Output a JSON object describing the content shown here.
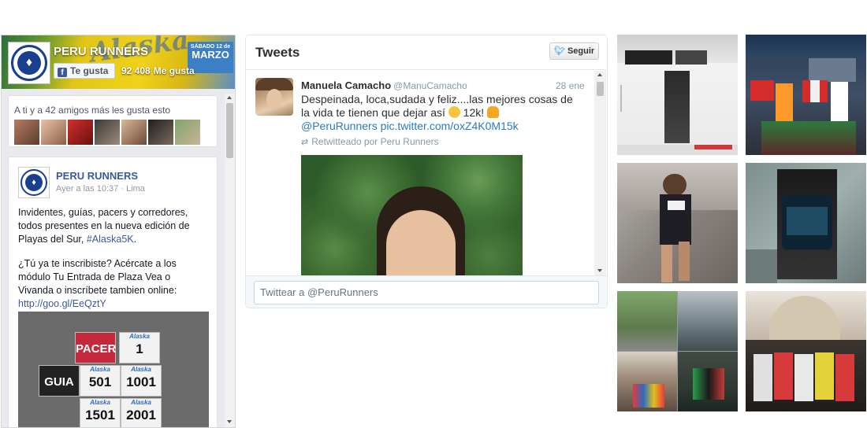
{
  "facebook": {
    "page_name": "PERU RUNNERS",
    "like_button": "Te gusta",
    "like_count": "92 408",
    "like_count_suffix": "Me gusta",
    "cover": {
      "brand": "Alaska",
      "event_day": "SÁBADO 12 de",
      "event_month": "MARZO"
    },
    "friends_text": "A ti y a 42 amigos más les gusta esto",
    "post": {
      "author": "PERU RUNNERS",
      "time": "Ayer a las 10:37 · Lima",
      "paragraph1": "Invidentes, guías, pacers y corredores, todos presentes en la nueva edición de Playas del Sur, ",
      "hashtag": "#Alaska5K",
      "paragraph1_end": ".",
      "paragraph2": "¿Tú ya te inscribiste? Acércate a los módulo Tu Entrada de Plaza Vea o Vivanda o inscríbete tambien online: ",
      "link": "http://goo.gl/EeQztY",
      "bibs": {
        "pacer": "PACER",
        "guia": "GUIA",
        "n1": "1",
        "n501": "501",
        "n1001": "1001",
        "n1501": "1501",
        "n2001": "2001",
        "brand": "Alaska"
      }
    }
  },
  "twitter": {
    "title": "Tweets",
    "follow_label": "Seguir",
    "tweet": {
      "author": "Manuela Camacho",
      "handle": "@ManuCamacho",
      "date": "28 ene",
      "text": "Despeinada, loca,sudada y feliz....las mejores cosas de la vida te tienen que dejar así",
      "text_tail": " 12k! ",
      "mention": "@PeruRunners",
      "pic_link": " pic.twitter.com/oxZ4K0M15k",
      "retweeted_by": "Retwitteado por Peru Runners"
    },
    "compose_placeholder": "Twittear a @PeruRunners"
  },
  "colors": {
    "facebook_blue": "#3b5998",
    "twitter_blue": "#55acee",
    "link_blue": "#2b7bb9"
  },
  "icons": [
    "facebook-f-icon",
    "twitter-bird-icon",
    "retweet-icon",
    "wink-emoji-icon",
    "flex-emoji-icon"
  ]
}
